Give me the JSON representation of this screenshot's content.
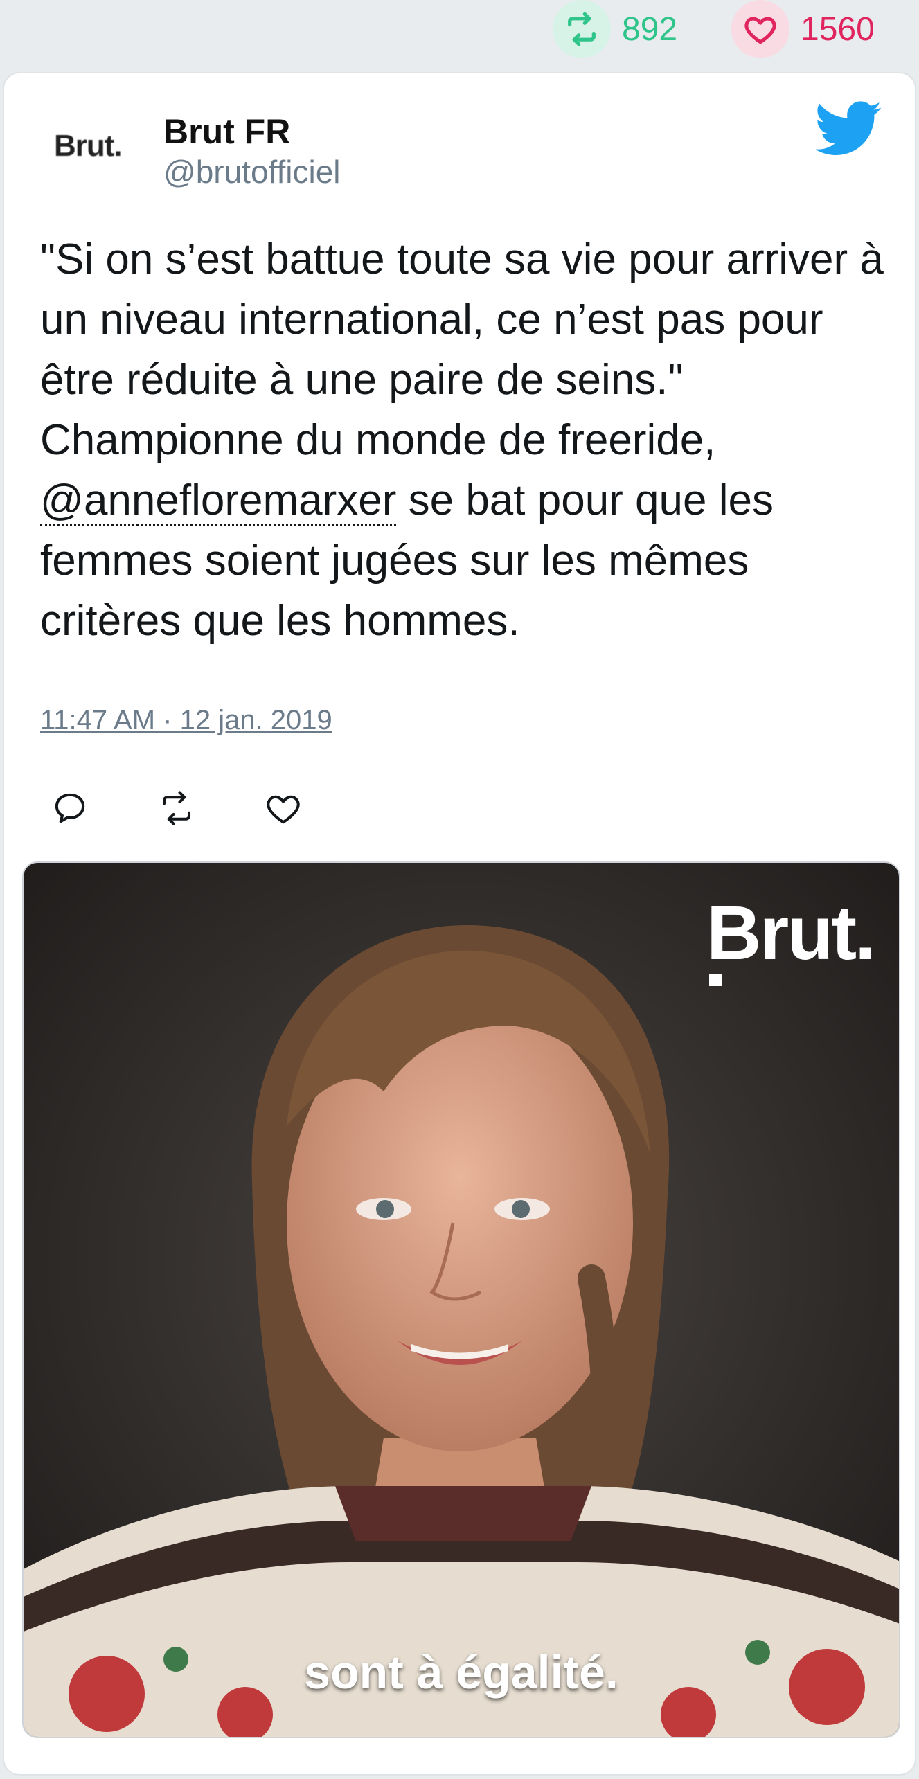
{
  "stats": {
    "retweets": "892",
    "likes": "1560"
  },
  "tweet": {
    "author_name": "Brut FR",
    "author_handle": "@brutofficiel",
    "avatar_text": "Brut.",
    "text_before": "\"Si on s’est battue toute sa vie pour arriver à un niveau international, ce n’est pas pour être réduite à une paire de seins.\" Championne du monde de freeride, ",
    "mention": "@annefloremarxer",
    "text_after": " se bat pour que les femmes soient jugées sur les mêmes critères que les hommes.",
    "timestamp": "11:47 AM · 12 jan. 2019"
  },
  "media": {
    "watermark": "Brut.",
    "subtitle": "sont à égalité."
  },
  "colors": {
    "retweet_green": "#2fc48a",
    "like_red": "#e0245e",
    "twitter_blue": "#1da1f2",
    "handle_gray": "#6b7b8a"
  },
  "icons": [
    "retweet-icon",
    "heart-icon",
    "twitter-bird-icon",
    "reply-icon"
  ]
}
